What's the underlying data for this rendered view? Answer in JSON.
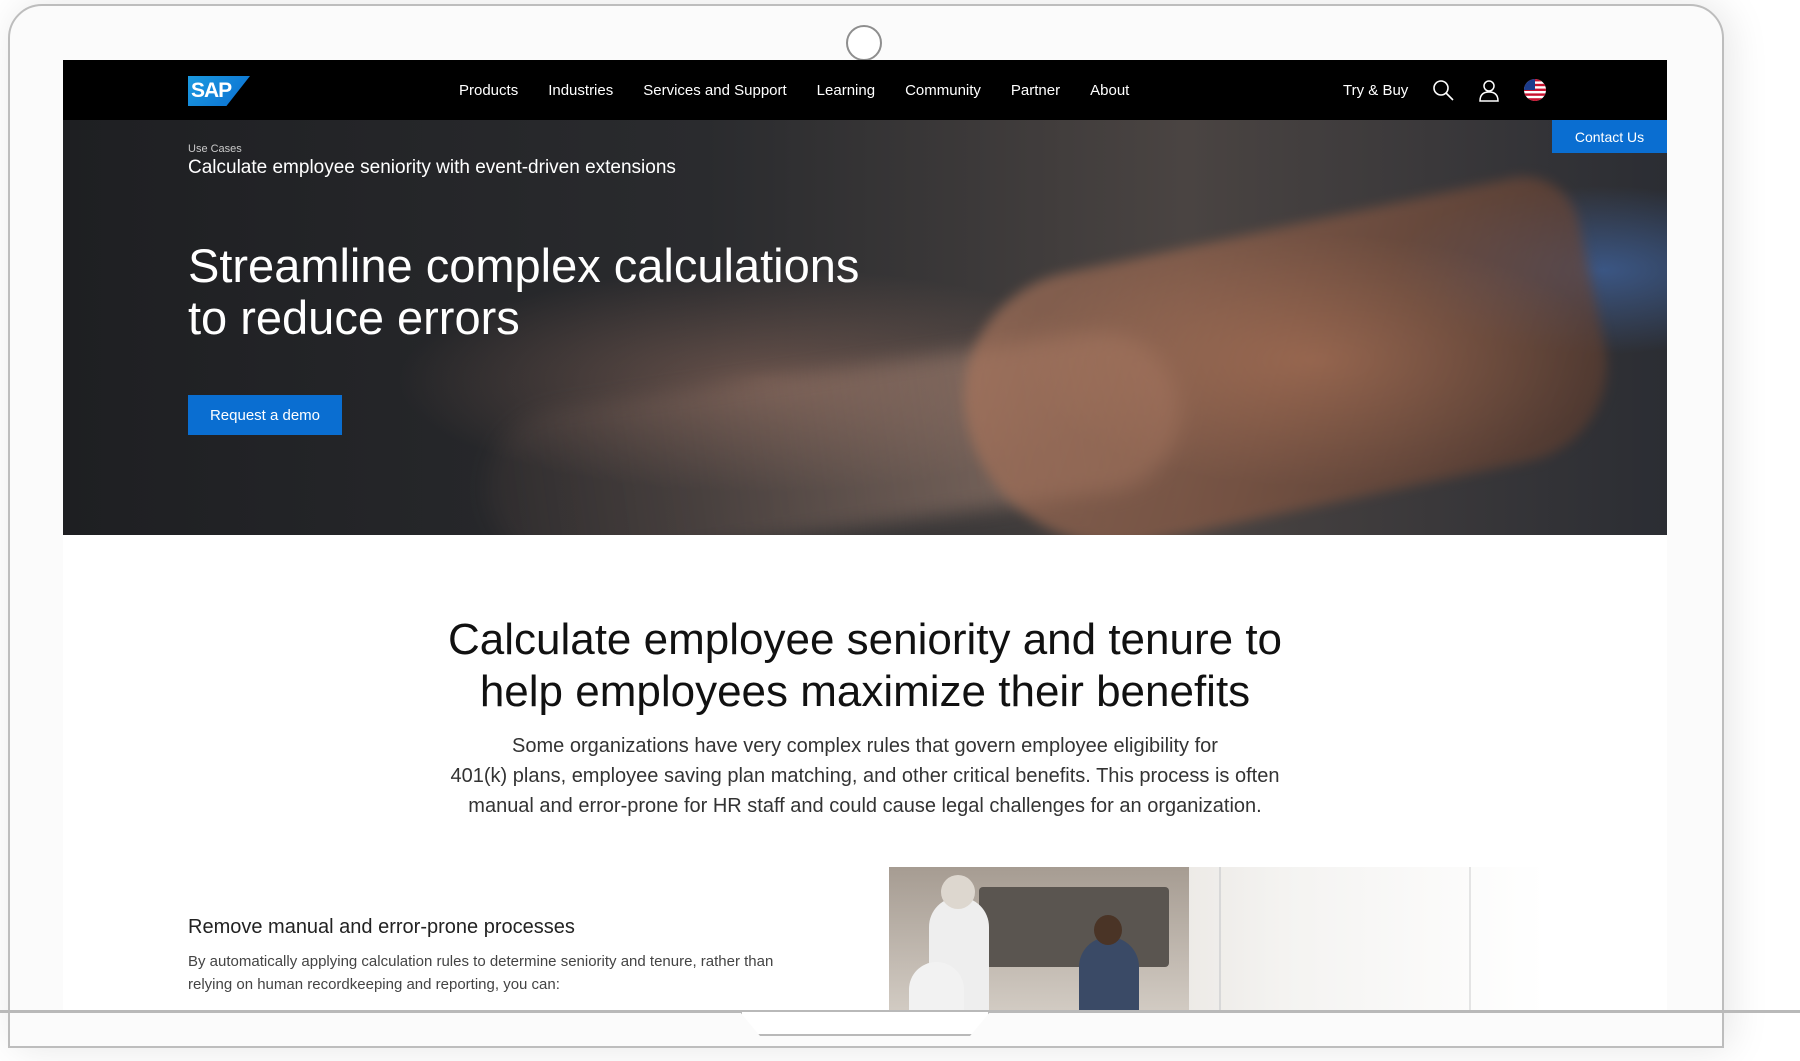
{
  "nav": {
    "logo_text": "SAP",
    "links": [
      "Products",
      "Industries",
      "Services and Support",
      "Learning",
      "Community",
      "Partner",
      "About"
    ],
    "try_buy": "Try & Buy",
    "icons": [
      "search-icon",
      "user-icon",
      "us-flag-icon"
    ]
  },
  "hero": {
    "breadcrumb": "Use Cases",
    "subtitle": "Calculate employee seniority with event-driven extensions",
    "title_line1": "Streamline complex calculations",
    "title_line2": "to reduce errors",
    "cta": "Request a demo"
  },
  "contact_us": "Contact Us",
  "intro": {
    "heading_line1": "Calculate employee seniority and tenure to",
    "heading_line2": "help employees maximize their benefits",
    "text_line1": "Some organizations have very complex rules that govern employee eligibility for",
    "text_line2": "401(k) plans, employee saving plan matching, and other critical benefits. This process is often",
    "text_line3": "manual and error-prone for HR staff and could cause legal challenges for an organization."
  },
  "feature": {
    "title": "Remove manual and error-prone processes",
    "text_line1": "By automatically applying calculation rules to determine seniority and tenure, rather than",
    "text_line2": "relying on human recordkeeping and reporting, you can:"
  },
  "colors": {
    "brand_blue": "#0a6ed1",
    "nav_bg": "#000000"
  }
}
